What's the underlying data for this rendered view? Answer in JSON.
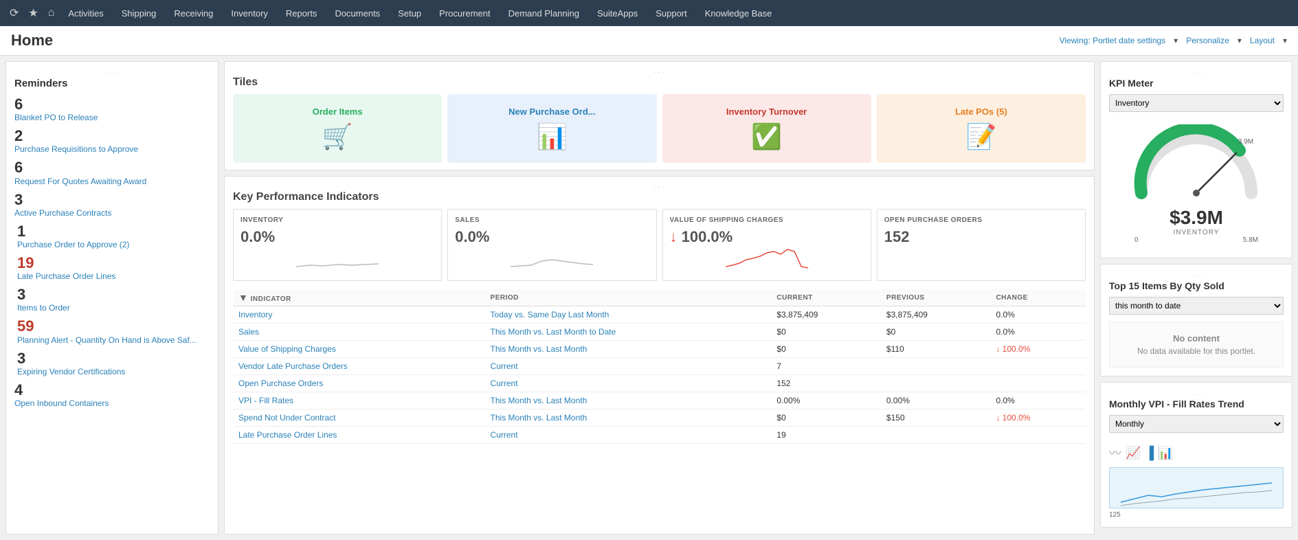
{
  "navbar": {
    "icons": [
      "history-icon",
      "star-icon",
      "home-icon"
    ],
    "items": [
      {
        "label": "Activities",
        "name": "nav-activities"
      },
      {
        "label": "Shipping",
        "name": "nav-shipping"
      },
      {
        "label": "Receiving",
        "name": "nav-receiving"
      },
      {
        "label": "Inventory",
        "name": "nav-inventory"
      },
      {
        "label": "Reports",
        "name": "nav-reports"
      },
      {
        "label": "Documents",
        "name": "nav-documents"
      },
      {
        "label": "Setup",
        "name": "nav-setup"
      },
      {
        "label": "Procurement",
        "name": "nav-procurement"
      },
      {
        "label": "Demand Planning",
        "name": "nav-demand-planning"
      },
      {
        "label": "SuiteApps",
        "name": "nav-suiteapps"
      },
      {
        "label": "Support",
        "name": "nav-support"
      },
      {
        "label": "Knowledge Base",
        "name": "nav-knowledge-base"
      }
    ]
  },
  "page": {
    "title": "Home",
    "header_right": {
      "viewing_label": "Viewing: Portlet date settings",
      "personalize_label": "Personalize",
      "layout_label": "Layout"
    }
  },
  "reminders": {
    "title": "Reminders",
    "items": [
      {
        "num": "6",
        "label": "Blanket PO to Release",
        "color": "plain",
        "bar": "none"
      },
      {
        "num": "2",
        "label": "Purchase Requisitions to Approve",
        "color": "plain",
        "bar": "none"
      },
      {
        "num": "6",
        "label": "Request For Quotes Awaiting Award",
        "color": "plain",
        "bar": "none"
      },
      {
        "num": "3",
        "label": "Active Purchase Contracts",
        "color": "plain",
        "bar": "none"
      },
      {
        "num": "1",
        "label": "Purchase Order to Approve (2)",
        "color": "plain",
        "bar": "bar-red"
      },
      {
        "num": "19",
        "label": "Late Purchase Order Lines",
        "color": "red",
        "bar": "bar-red"
      },
      {
        "num": "3",
        "label": "Items to Order",
        "color": "plain",
        "bar": "bar-orange"
      },
      {
        "num": "59",
        "label": "Planning Alert - Quantity On Hand is Above Saf...",
        "color": "red",
        "bar": "bar-red"
      },
      {
        "num": "3",
        "label": "Expiring Vendor Certifications",
        "color": "plain",
        "bar": "bar-yellow"
      },
      {
        "num": "4",
        "label": "Open Inbound Containers",
        "color": "plain",
        "bar": "none"
      }
    ]
  },
  "tiles": {
    "section_label": "Tiles",
    "items": [
      {
        "label": "Order Items",
        "color": "green",
        "icon": "🛒"
      },
      {
        "label": "New Purchase Ord...",
        "color": "blue",
        "icon": "📊"
      },
      {
        "label": "Inventory Turnover",
        "color": "pink",
        "icon": "✅"
      },
      {
        "label": "Late POs (5)",
        "color": "orange",
        "icon": "📝"
      }
    ]
  },
  "kpi": {
    "section_label": "Key Performance Indicators",
    "cards": [
      {
        "title": "INVENTORY",
        "value": "0.0%",
        "has_arrow": false
      },
      {
        "title": "SALES",
        "value": "0.0%",
        "has_arrow": false
      },
      {
        "title": "VALUE OF SHIPPING CHARGES",
        "value": "100.0%",
        "has_arrow": true
      },
      {
        "title": "OPEN PURCHASE ORDERS",
        "value": "152",
        "has_arrow": false
      }
    ],
    "table": {
      "headers": [
        "INDICATOR",
        "PERIOD",
        "CURRENT",
        "PREVIOUS",
        "CHANGE"
      ],
      "rows": [
        {
          "indicator": "Inventory",
          "period": "Today vs. Same Day Last Month",
          "current": "$3,875,409",
          "previous": "$3,875,409",
          "change": "0.0%",
          "change_down": false
        },
        {
          "indicator": "Sales",
          "period": "This Month vs. Last Month to Date",
          "current": "$0",
          "previous": "$0",
          "change": "0.0%",
          "change_down": false
        },
        {
          "indicator": "Value of Shipping Charges",
          "period": "This Month vs. Last Month",
          "current": "$0",
          "previous": "$110",
          "change": "↓ 100.0%",
          "change_down": true
        },
        {
          "indicator": "Vendor Late Purchase Orders",
          "period": "Current",
          "current": "7",
          "previous": "",
          "change": "",
          "change_down": false
        },
        {
          "indicator": "Open Purchase Orders",
          "period": "Current",
          "current": "152",
          "previous": "",
          "change": "",
          "change_down": false
        },
        {
          "indicator": "VPI - Fill Rates",
          "period": "This Month vs. Last Month",
          "current": "0.00%",
          "previous": "0.00%",
          "change": "0.0%",
          "change_down": false
        },
        {
          "indicator": "Spend Not Under Contract",
          "period": "This Month vs. Last Month",
          "current": "$0",
          "previous": "$150",
          "change": "↓ 100.0%",
          "change_down": true
        },
        {
          "indicator": "Late Purchase Order Lines",
          "period": "Current",
          "current": "19",
          "previous": "",
          "change": "",
          "change_down": false
        }
      ]
    }
  },
  "kpi_meter": {
    "title": "KPI Meter",
    "select_label": "Inventory",
    "gauge_value": "$3.9M",
    "gauge_sublabel": "INVENTORY",
    "gauge_min": "0",
    "gauge_max": "5.8M",
    "gauge_mid": "3.9M"
  },
  "top15": {
    "title": "Top 15 Items By Qty Sold",
    "select_label": "this month to date",
    "no_content_title": "No content",
    "no_content_body": "No data available for this portlet."
  },
  "monthly_vpi": {
    "title": "Monthly VPI - Fill Rates Trend",
    "select_label": "Monthly",
    "chart_label": "125"
  }
}
